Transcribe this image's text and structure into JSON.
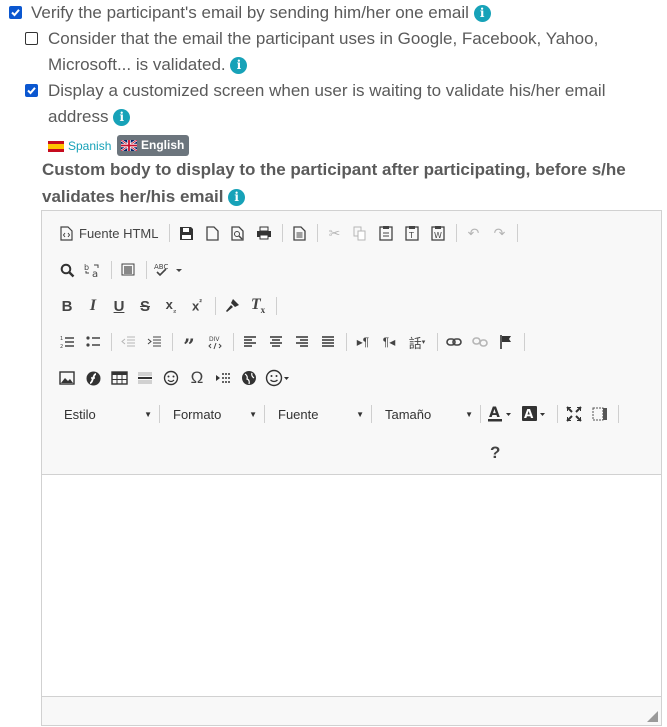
{
  "options": {
    "verify_email": {
      "label": "Verify the participant's email by sending him/her one email",
      "checked": true
    },
    "consider_validated": {
      "label": "Consider that the email the participant uses in Google, Facebook, Yahoo, Microsoft... is validated.",
      "checked": false
    },
    "custom_screen": {
      "label": "Display a customized screen when user is waiting to validate his/her email address",
      "checked": true
    }
  },
  "info_glyph": "i",
  "languages": [
    {
      "label": "Spanish",
      "active": false
    },
    {
      "label": "English",
      "active": true
    }
  ],
  "custom_body_label": "Custom body to display to the participant after participating, before s/he validates her/his email",
  "editor": {
    "source_button_label": "Fuente HTML",
    "combos": {
      "style": "Estilo",
      "format": "Formato",
      "font": "Fuente",
      "size": "Tamaño"
    },
    "help_label": "?",
    "content": ""
  },
  "colors": {
    "checkbox": "#0b57d0",
    "info": "#17a2b8",
    "lang_active_bg": "#6c757d"
  }
}
